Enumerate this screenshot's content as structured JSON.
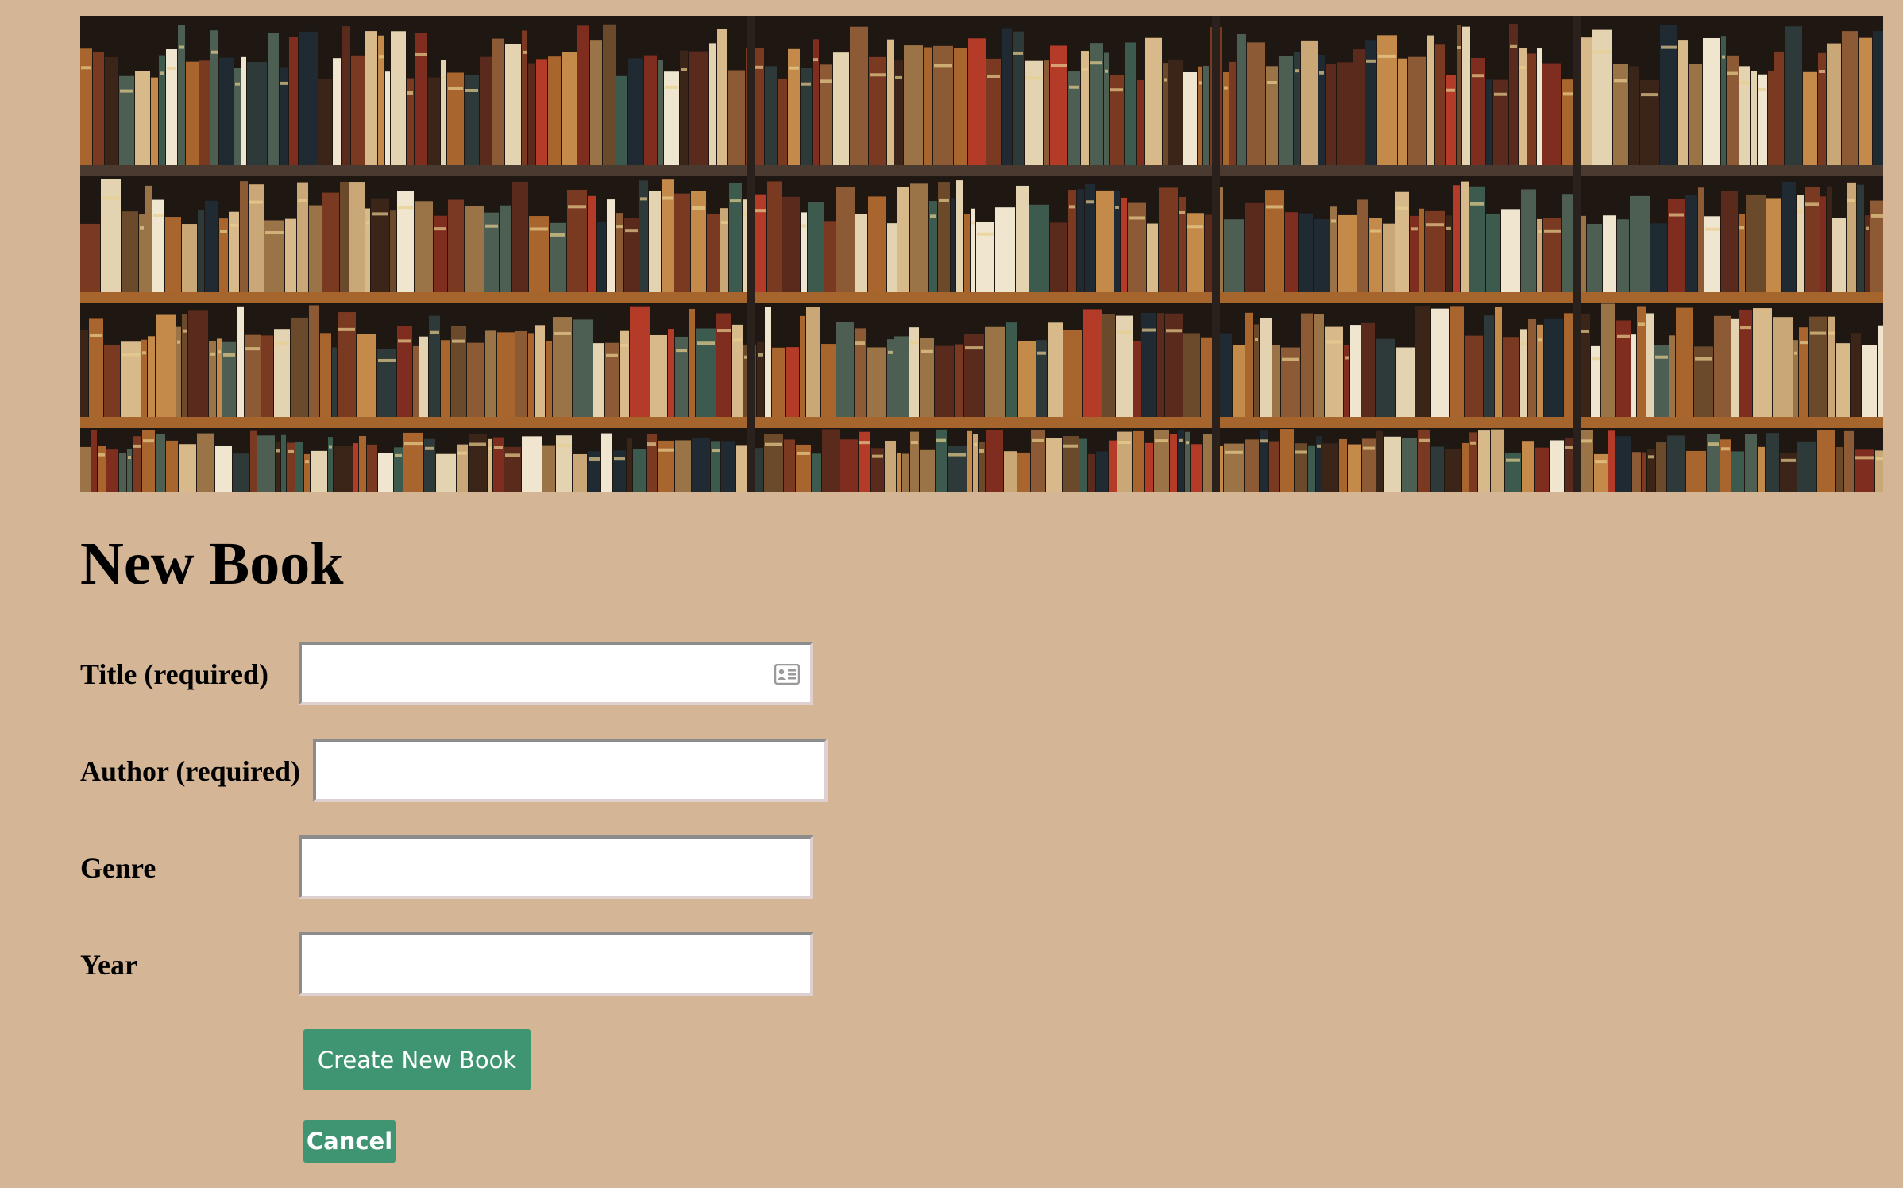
{
  "banner": {
    "image": "bookshelf-photo"
  },
  "page": {
    "title": "New Book"
  },
  "form": {
    "fields": [
      {
        "label": "Title (required)",
        "value": "",
        "icon": "contact-card-icon"
      },
      {
        "label": "Author (required)",
        "value": ""
      },
      {
        "label": "Genre",
        "value": ""
      },
      {
        "label": "Year",
        "value": ""
      }
    ],
    "submit_label": "Create New Book",
    "cancel_label": "Cancel"
  },
  "colors": {
    "background": "#d4b596",
    "button": "#3f9571",
    "button_text": "#ffffff"
  }
}
